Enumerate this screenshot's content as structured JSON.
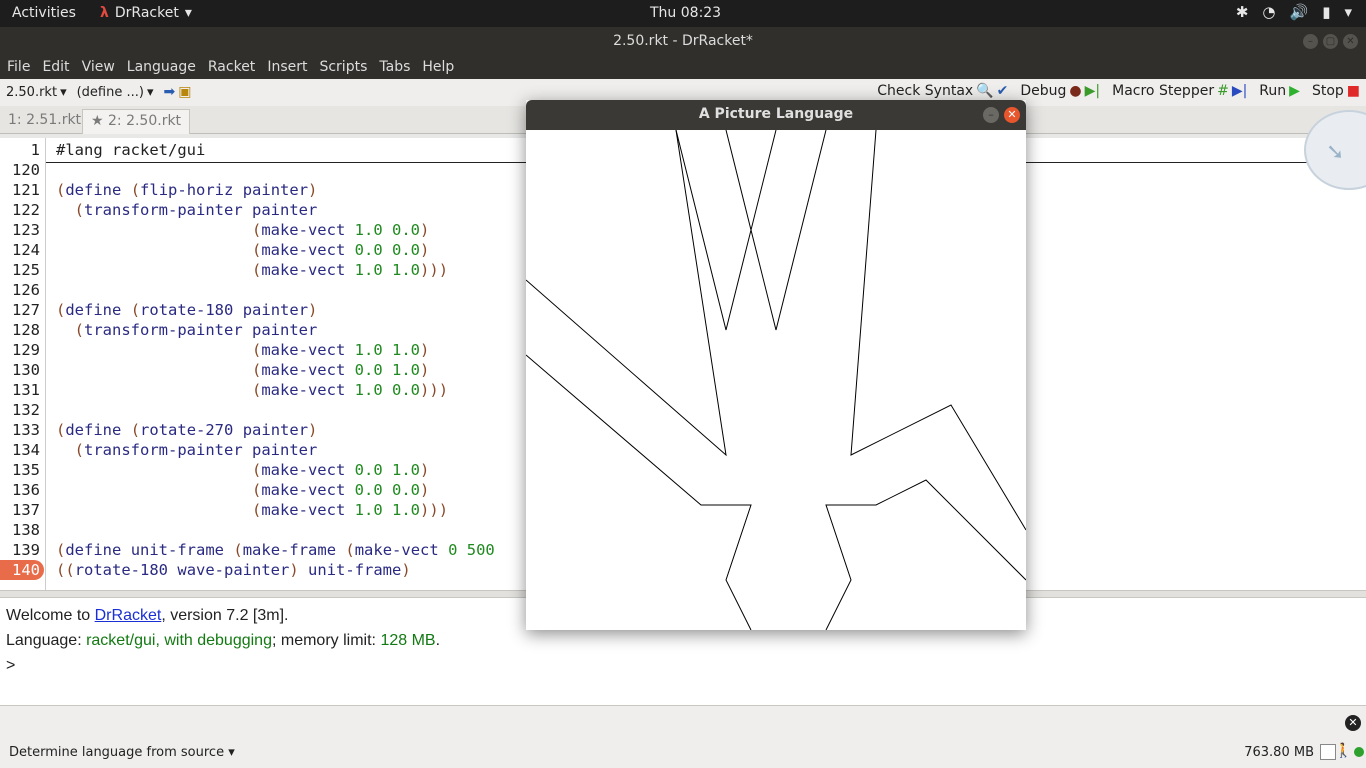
{
  "topbar": {
    "activities": "Activities",
    "app_name": "DrRacket",
    "clock": "Thu 08:23"
  },
  "window": {
    "title": "2.50.rkt - DrRacket*"
  },
  "menu": [
    "File",
    "Edit",
    "View",
    "Language",
    "Racket",
    "Insert",
    "Scripts",
    "Tabs",
    "Help"
  ],
  "toolbar": {
    "file_selector": "2.50.rkt",
    "define_selector": "(define ...)",
    "check_syntax": "Check Syntax",
    "debug": "Debug",
    "macro_stepper": "Macro Stepper",
    "run": "Run",
    "stop": "Stop"
  },
  "tabs": [
    {
      "label": "1: 2.51.rkt"
    },
    {
      "label": "★ 2: 2.50.rkt"
    }
  ],
  "editor": {
    "pinned_line_number": "1",
    "pinned_line": "#lang racket/gui",
    "lines": [
      {
        "n": "120",
        "code": ""
      },
      {
        "n": "121",
        "code": "(define (flip-horiz painter)"
      },
      {
        "n": "122",
        "code": "  (transform-painter painter"
      },
      {
        "n": "123",
        "code": "                     (make-vect 1.0 0.0)"
      },
      {
        "n": "124",
        "code": "                     (make-vect 0.0 0.0)"
      },
      {
        "n": "125",
        "code": "                     (make-vect 1.0 1.0)))"
      },
      {
        "n": "126",
        "code": ""
      },
      {
        "n": "127",
        "code": "(define (rotate-180 painter)"
      },
      {
        "n": "128",
        "code": "  (transform-painter painter"
      },
      {
        "n": "129",
        "code": "                     (make-vect 1.0 1.0)"
      },
      {
        "n": "130",
        "code": "                     (make-vect 0.0 1.0)"
      },
      {
        "n": "131",
        "code": "                     (make-vect 1.0 0.0)))"
      },
      {
        "n": "132",
        "code": ""
      },
      {
        "n": "133",
        "code": "(define (rotate-270 painter)"
      },
      {
        "n": "134",
        "code": "  (transform-painter painter"
      },
      {
        "n": "135",
        "code": "                     (make-vect 0.0 1.0)"
      },
      {
        "n": "136",
        "code": "                     (make-vect 0.0 0.0)"
      },
      {
        "n": "137",
        "code": "                     (make-vect 1.0 1.0)))"
      },
      {
        "n": "138",
        "code": ""
      },
      {
        "n": "139",
        "code": "(define unit-frame (make-frame (make-vect 0 500"
      },
      {
        "n": "140",
        "code": "((rotate-180 wave-painter) unit-frame)"
      }
    ]
  },
  "repl": {
    "welcome_prefix": "Welcome to ",
    "welcome_link": "DrRacket",
    "welcome_suffix": ", version 7.2 [3m].",
    "language_prefix": "Language: ",
    "language_value": "racket/gui, with debugging",
    "language_mid": "; memory limit: ",
    "memory_limit": "128 MB",
    "language_end": ".",
    "prompt": ">"
  },
  "status": {
    "language_selector": "Determine language from source",
    "memory": "763.80 MB"
  },
  "picture_window": {
    "title": "A Picture Language"
  }
}
